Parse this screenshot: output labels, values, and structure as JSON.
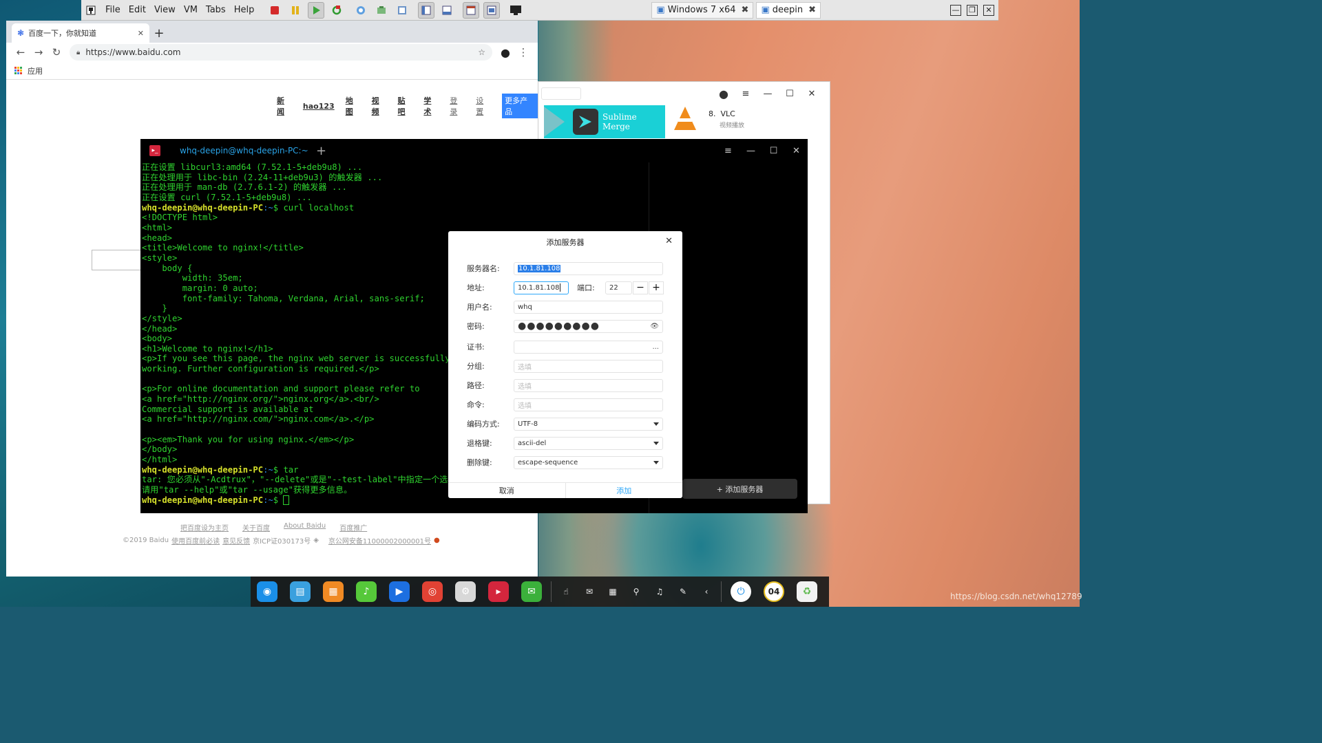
{
  "vmware": {
    "menus": [
      "File",
      "Edit",
      "View",
      "VM",
      "Tabs",
      "Help"
    ],
    "tabs": [
      {
        "label": "Windows 7 x64",
        "icon": "vm-icon"
      },
      {
        "label": "deepin",
        "icon": "vm-icon"
      }
    ]
  },
  "chrome": {
    "tab_title": "百度一下，你就知道",
    "url": "https://www.baidu.com",
    "bookmark_apps": "应用"
  },
  "baidu": {
    "nav": [
      "新闻",
      "hao123",
      "地图",
      "视频",
      "贴吧",
      "学术"
    ],
    "login": "登录",
    "settings": "设置",
    "more": "更多产品",
    "footer_links": [
      "把百度设为主页",
      "关于百度",
      "About Baidu",
      "百度推广"
    ],
    "copyright": "©2019 Baidu",
    "footer_line2": [
      "使用百度前必读",
      "意见反馈",
      "京ICP证030173号",
      "京公网安备11000002000001号"
    ]
  },
  "store": {
    "banner_name": "Sublime Merge",
    "vlc_rank": "8.",
    "vlc_name": "VLC",
    "vlc_desc": "视频播放"
  },
  "terminal": {
    "tab_title": "whq-deepin@whq-deepin-PC:~",
    "prompt_user": "whq-deepin@whq-deepin-PC",
    "prompt_path": ":~",
    "lines_pre": [
      "正在设置 libcurl3:amd64 (7.52.1-5+deb9u8) ...",
      "正在处理用于 libc-bin (2.24-11+deb9u3) 的触发器 ...",
      "正在处理用于 man-db (2.7.6.1-2) 的触发器 ...",
      "正在设置 curl (7.52.1-5+deb9u8) ..."
    ],
    "cmd1": "$ curl localhost",
    "html_output": [
      "<!DOCTYPE html>",
      "<html>",
      "<head>",
      "<title>Welcome to nginx!</title>",
      "<style>",
      "    body {",
      "        width: 35em;",
      "        margin: 0 auto;",
      "        font-family: Tahoma, Verdana, Arial, sans-serif;",
      "    }",
      "</style>",
      "</head>",
      "<body>",
      "<h1>Welcome to nginx!</h1>",
      "<p>If you see this page, the nginx web server is successfully installed and",
      "working. Further configuration is required.</p>",
      "",
      "<p>For online documentation and support please refer to",
      "<a href=\"http://nginx.org/\">nginx.org</a>.<br/>",
      "Commercial support is available at",
      "<a href=\"http://nginx.com/\">nginx.com</a>.</p>",
      "",
      "<p><em>Thank you for using nginx.</em></p>",
      "</body>",
      "</html>"
    ],
    "cmd2": "$ tar",
    "tar_output": [
      "tar: 您必须从\"-Acdtrux\"，\"--delete\"或是\"--test-label\"中指定一个选项",
      "请用\"tar --help\"或\"tar --usage\"获得更多信息。"
    ],
    "cmd3": "$ ",
    "add_server_button": "+ 添加服务器"
  },
  "dialog": {
    "title": "添加服务器",
    "server_name_label": "服务器名:",
    "server_name_value": "10.1.81.108",
    "address_label": "地址:",
    "address_value": "10.1.81.108",
    "port_label": "端口:",
    "port_value": "22",
    "username_label": "用户名:",
    "username_value": "whq",
    "password_label": "密码:",
    "password_dots": "●●●●●●●●●",
    "cert_label": "证书:",
    "cert_browse": "...",
    "group_label": "分组:",
    "group_placeholder": "选填",
    "path_label": "路径:",
    "path_placeholder": "选填",
    "command_label": "命令:",
    "command_placeholder": "选填",
    "encoding_label": "编码方式:",
    "encoding_value": "UTF-8",
    "backspace_label": "退格键:",
    "backspace_value": "ascii-del",
    "delete_label": "删除键:",
    "delete_value": "escape-sequence",
    "cancel": "取消",
    "add": "添加"
  },
  "dock": {
    "apps": [
      {
        "name": "launcher-icon",
        "color": "#1a8fe8",
        "glyph": "◉"
      },
      {
        "name": "file-manager-icon",
        "color": "#3aa0de",
        "glyph": "▤"
      },
      {
        "name": "app-store-icon",
        "color": "#f08a24",
        "glyph": "▦"
      },
      {
        "name": "music-icon",
        "color": "#56c83a",
        "glyph": "♪"
      },
      {
        "name": "movie-icon",
        "color": "#1d6fe0",
        "glyph": "▶"
      },
      {
        "name": "chrome-icon",
        "color": "#e14234",
        "glyph": "◎"
      },
      {
        "name": "settings-icon",
        "color": "#d8d8d8",
        "glyph": "⚙"
      },
      {
        "name": "terminal-icon",
        "color": "#d4263d",
        "glyph": "▸"
      },
      {
        "name": "wechat-icon",
        "color": "#3bb03b",
        "glyph": "✉"
      }
    ],
    "tray": [
      "☝",
      "✉",
      "▦",
      "⚲",
      "♫",
      "✎",
      "‹"
    ],
    "clock": "04"
  },
  "watermark": "https://blog.csdn.net/whq12789"
}
